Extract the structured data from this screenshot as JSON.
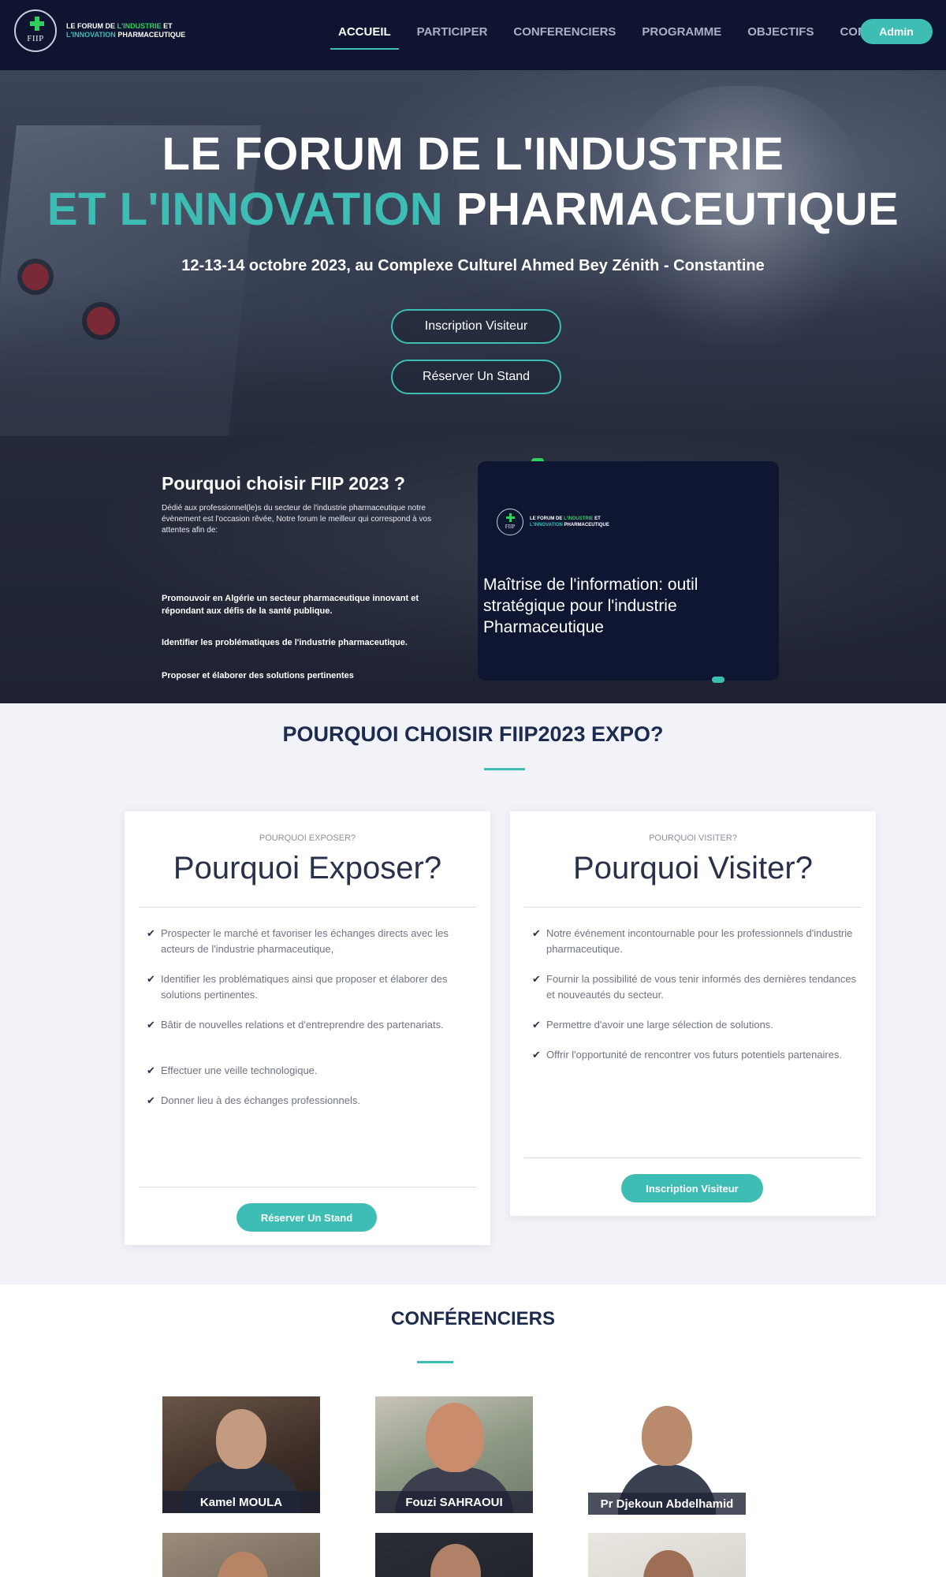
{
  "header": {
    "logo_abbr": "FIIP",
    "brand_line1_a": "LE FORUM DE ",
    "brand_line1_b": "L'INDUSTRIE",
    "brand_line1_c": " ET",
    "brand_line2_a": "L'INNOVATION",
    "brand_line2_b": " PHARMACEUTIQUE",
    "nav": [
      "ACCUEIL",
      "PARTICIPER",
      "CONFERENCIERS",
      "PROGRAMME",
      "OBJECTIFS",
      "CONTACT"
    ],
    "active_nav": "ACCUEIL",
    "admin_label": "Admin"
  },
  "hero": {
    "title_line1": "LE FORUM DE L'INDUSTRIE",
    "title_line2_accent": "ET L'INNOVATION",
    "title_line2_rest": " PHARMACEUTIQUE",
    "subtitle": "12-13-14 octobre 2023, au Complexe Culturel Ahmed Bey Zénith - Constantine",
    "btn_visitor": "Inscription Visiteur",
    "btn_stand": "Réserver Un Stand"
  },
  "why": {
    "heading": "Pourquoi choisir FIIP 2023 ?",
    "intro": "Dédié aux professionnel(le)s du secteur de l'industrie pharmaceutique notre évènement est l'occasion rêvée, Notre forum le meilleur qui correspond à vos attentes afin de:",
    "points": [
      "Promouvoir en Algérie un secteur pharmaceutique innovant et répondant aux défis de la santé publique.",
      "Identifier les problématiques de l'industrie pharmaceutique.",
      "Proposer et élaborer des solutions pertinentes"
    ],
    "card_logo_abbr": "FIIP",
    "card_brand_line1_a": "LE FORUM DE ",
    "card_brand_line1_b": "L'INDUSTRIE",
    "card_brand_line1_c": " ET",
    "card_brand_line2_a": "L'INNOVATION",
    "card_brand_line2_b": " PHARMACEUTIQUE",
    "card_text": "Maîtrise de l'information: outil stratégique pour l'industrie Pharmaceutique"
  },
  "expo": {
    "title": "POURQUOI CHOISIR FIIP2023 EXPO?",
    "expose": {
      "kicker": "POURQUOI EXPOSER?",
      "title": "Pourquoi Exposer?",
      "items": [
        "Prospecter le marché et favoriser les échanges directs avec les acteurs de l'industrie pharmaceutique,",
        "Identifier les problématiques ainsi que proposer et élaborer des solutions pertinentes.",
        "Bâtir de nouvelles relations et d'entreprendre des partenariats.",
        "Effectuer une veille technologique.",
        "Donner lieu à des échanges professionnels."
      ],
      "button": "Réserver Un Stand"
    },
    "visit": {
      "kicker": "POURQUOI VISITER?",
      "title": "Pourquoi Visiter?",
      "items": [
        "Notre événement incontournable pour les professionnels d'industrie pharmaceutique.",
        "Fournir la possibilité de vous tenir informés des dernières tendances et nouveautés du secteur.",
        "Permettre d'avoir une large sélection de solutions.",
        "Offrir l'opportunité de rencontrer vos futurs potentiels partenaires."
      ],
      "button": "Inscription Visiteur"
    }
  },
  "speakers": {
    "title": "CONFÉRENCIERS",
    "list": [
      {
        "name": "Kamel MOULA"
      },
      {
        "name": "Fouzi SAHRAOUI"
      },
      {
        "name": "Pr Djekoun Abdelhamid"
      },
      {
        "name": ""
      },
      {
        "name": ""
      },
      {
        "name": ""
      }
    ]
  },
  "colors": {
    "navy": "#0f1530",
    "accent": "#3dbdb3",
    "green": "#2fd15e"
  }
}
